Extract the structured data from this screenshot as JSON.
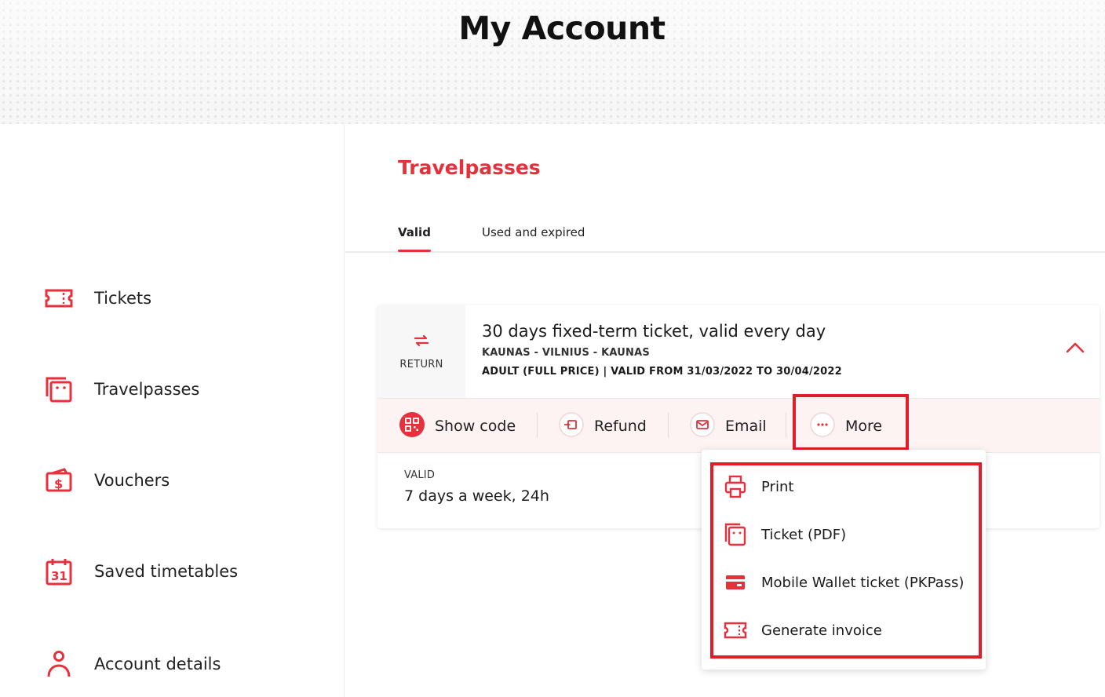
{
  "header": {
    "title": "My Account"
  },
  "sidebar": {
    "items": [
      {
        "label": "Tickets",
        "icon": "ticket-icon"
      },
      {
        "label": "Travelpasses",
        "icon": "travelpass-icon"
      },
      {
        "label": "Vouchers",
        "icon": "voucher-icon"
      },
      {
        "label": "Saved timetables",
        "icon": "calendar-icon"
      },
      {
        "label": "Account details",
        "icon": "user-icon"
      }
    ]
  },
  "main": {
    "title": "Travelpasses",
    "tabs": [
      {
        "label": "Valid",
        "active": true
      },
      {
        "label": "Used and expired",
        "active": false
      }
    ],
    "card": {
      "trip_type": "RETURN",
      "title": "30 days fixed-term ticket, valid every day",
      "route": "KAUNAS - VILNIUS - KAUNAS",
      "fare": "ADULT (FULL PRICE) | VALID FROM 31/03/2022 TO 30/04/2022",
      "actions": {
        "show_code": "Show code",
        "refund": "Refund",
        "email": "Email",
        "more": "More"
      },
      "validity_label": "VALID",
      "validity_value": "7 days a week, 24h"
    },
    "more_menu": {
      "items": [
        {
          "label": "Print",
          "icon": "printer-icon"
        },
        {
          "label": "Ticket (PDF)",
          "icon": "pdf-ticket-icon"
        },
        {
          "label": "Mobile Wallet ticket (PKPass)",
          "icon": "wallet-icon"
        },
        {
          "label": "Generate invoice",
          "icon": "invoice-icon"
        }
      ]
    }
  },
  "colors": {
    "accent": "#e6303c",
    "highlight_border": "#e11d2a",
    "action_bar_bg": "#fdf3f3"
  }
}
